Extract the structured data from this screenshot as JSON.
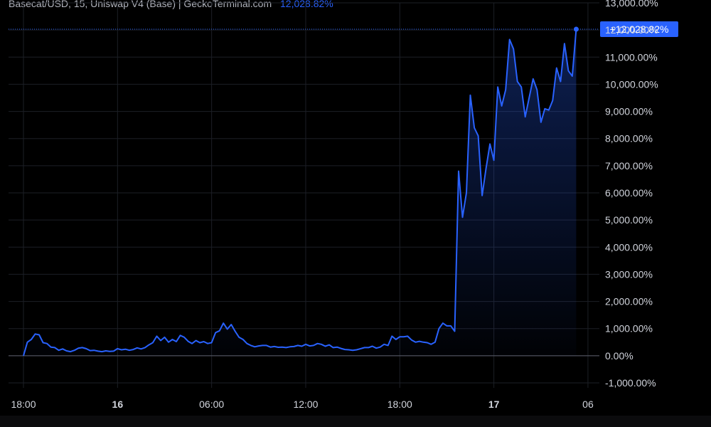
{
  "header": {
    "symbol": "Basecat/USD, 15, Uniswap V4 (Base) | GeckoTerminal.com",
    "value": "12,028.82%"
  },
  "colors": {
    "line": "#2962ff",
    "grid": "#1c1f26",
    "background": "#000000",
    "text": "#d1d4dc"
  },
  "chart_data": {
    "type": "area",
    "title": "",
    "xlabel": "",
    "ylabel": "",
    "ylim": [
      -1000,
      13000
    ],
    "y_ticks": [
      -1000,
      0,
      1000,
      2000,
      3000,
      4000,
      5000,
      6000,
      7000,
      8000,
      9000,
      10000,
      11000,
      12000,
      13000
    ],
    "y_tick_labels": [
      "-1,000.00%",
      "0.00%",
      "1,000.00%",
      "2,000.00%",
      "3,000.00%",
      "4,000.00%",
      "5,000.00%",
      "6,000.00%",
      "7,000.00%",
      "8,000.00%",
      "9,000.00%",
      "10,000.00%",
      "11,000.00%",
      "12,000.00%",
      "13,000.00%"
    ],
    "x_range": [
      "2024-01-15 18:00",
      "2024-01-17 07:00"
    ],
    "x_ticks": [
      {
        "label": "18:00",
        "x": "2024-01-15 18:00",
        "bold": false
      },
      {
        "label": "16",
        "x": "2024-01-16 00:00",
        "bold": true
      },
      {
        "label": "06:00",
        "x": "2024-01-16 06:00",
        "bold": false
      },
      {
        "label": "12:00",
        "x": "2024-01-16 12:00",
        "bold": false
      },
      {
        "label": "18:00",
        "x": "2024-01-16 18:00",
        "bold": false
      },
      {
        "label": "17",
        "x": "2024-01-17 00:00",
        "bold": true
      },
      {
        "label": "06",
        "x": "2024-01-17 06:00",
        "bold": false
      }
    ],
    "grid": true,
    "last_value_label": "+12,028.82%",
    "last_value": 12028.82,
    "series": [
      {
        "name": "",
        "points": [
          [
            "2024-01-15 18:00",
            0
          ],
          [
            "2024-01-15 18:15",
            500
          ],
          [
            "2024-01-15 18:30",
            600
          ],
          [
            "2024-01-15 18:45",
            800
          ],
          [
            "2024-01-15 19:00",
            770
          ],
          [
            "2024-01-15 19:15",
            480
          ],
          [
            "2024-01-15 19:30",
            450
          ],
          [
            "2024-01-15 19:45",
            320
          ],
          [
            "2024-01-15 20:00",
            300
          ],
          [
            "2024-01-15 20:15",
            200
          ],
          [
            "2024-01-15 20:30",
            250
          ],
          [
            "2024-01-15 20:45",
            180
          ],
          [
            "2024-01-15 21:00",
            150
          ],
          [
            "2024-01-15 21:15",
            200
          ],
          [
            "2024-01-15 21:30",
            280
          ],
          [
            "2024-01-15 21:45",
            300
          ],
          [
            "2024-01-15 22:00",
            260
          ],
          [
            "2024-01-15 22:15",
            190
          ],
          [
            "2024-01-15 22:30",
            200
          ],
          [
            "2024-01-15 22:45",
            170
          ],
          [
            "2024-01-15 23:00",
            150
          ],
          [
            "2024-01-15 23:15",
            180
          ],
          [
            "2024-01-15 23:30",
            160
          ],
          [
            "2024-01-15 23:45",
            170
          ],
          [
            "2024-01-16 00:00",
            260
          ],
          [
            "2024-01-16 00:15",
            220
          ],
          [
            "2024-01-16 00:30",
            240
          ],
          [
            "2024-01-16 00:45",
            200
          ],
          [
            "2024-01-16 01:00",
            230
          ],
          [
            "2024-01-16 01:15",
            290
          ],
          [
            "2024-01-16 01:30",
            250
          ],
          [
            "2024-01-16 01:45",
            300
          ],
          [
            "2024-01-16 02:00",
            400
          ],
          [
            "2024-01-16 02:15",
            480
          ],
          [
            "2024-01-16 02:30",
            720
          ],
          [
            "2024-01-16 02:45",
            560
          ],
          [
            "2024-01-16 03:00",
            680
          ],
          [
            "2024-01-16 03:15",
            500
          ],
          [
            "2024-01-16 03:30",
            600
          ],
          [
            "2024-01-16 03:45",
            520
          ],
          [
            "2024-01-16 04:00",
            750
          ],
          [
            "2024-01-16 04:15",
            680
          ],
          [
            "2024-01-16 04:30",
            530
          ],
          [
            "2024-01-16 04:45",
            450
          ],
          [
            "2024-01-16 05:00",
            560
          ],
          [
            "2024-01-16 05:15",
            480
          ],
          [
            "2024-01-16 05:30",
            520
          ],
          [
            "2024-01-16 05:45",
            450
          ],
          [
            "2024-01-16 06:00",
            480
          ],
          [
            "2024-01-16 06:15",
            850
          ],
          [
            "2024-01-16 06:30",
            920
          ],
          [
            "2024-01-16 06:45",
            1200
          ],
          [
            "2024-01-16 07:00",
            980
          ],
          [
            "2024-01-16 07:15",
            1150
          ],
          [
            "2024-01-16 07:30",
            900
          ],
          [
            "2024-01-16 07:45",
            680
          ],
          [
            "2024-01-16 08:00",
            600
          ],
          [
            "2024-01-16 08:15",
            450
          ],
          [
            "2024-01-16 08:30",
            380
          ],
          [
            "2024-01-16 08:45",
            330
          ],
          [
            "2024-01-16 09:00",
            360
          ],
          [
            "2024-01-16 09:15",
            380
          ],
          [
            "2024-01-16 09:30",
            380
          ],
          [
            "2024-01-16 09:45",
            320
          ],
          [
            "2024-01-16 10:00",
            340
          ],
          [
            "2024-01-16 10:15",
            310
          ],
          [
            "2024-01-16 10:30",
            320
          ],
          [
            "2024-01-16 10:45",
            300
          ],
          [
            "2024-01-16 11:00",
            330
          ],
          [
            "2024-01-16 11:15",
            340
          ],
          [
            "2024-01-16 11:30",
            380
          ],
          [
            "2024-01-16 11:45",
            350
          ],
          [
            "2024-01-16 12:00",
            420
          ],
          [
            "2024-01-16 12:15",
            360
          ],
          [
            "2024-01-16 12:30",
            380
          ],
          [
            "2024-01-16 12:45",
            450
          ],
          [
            "2024-01-16 13:00",
            420
          ],
          [
            "2024-01-16 13:15",
            350
          ],
          [
            "2024-01-16 13:30",
            400
          ],
          [
            "2024-01-16 13:45",
            300
          ],
          [
            "2024-01-16 14:00",
            320
          ],
          [
            "2024-01-16 14:15",
            270
          ],
          [
            "2024-01-16 14:30",
            230
          ],
          [
            "2024-01-16 14:45",
            220
          ],
          [
            "2024-01-16 15:00",
            200
          ],
          [
            "2024-01-16 15:15",
            220
          ],
          [
            "2024-01-16 15:30",
            260
          ],
          [
            "2024-01-16 15:45",
            300
          ],
          [
            "2024-01-16 16:00",
            300
          ],
          [
            "2024-01-16 16:15",
            350
          ],
          [
            "2024-01-16 16:30",
            280
          ],
          [
            "2024-01-16 16:45",
            320
          ],
          [
            "2024-01-16 17:00",
            420
          ],
          [
            "2024-01-16 17:15",
            380
          ],
          [
            "2024-01-16 17:30",
            720
          ],
          [
            "2024-01-16 17:45",
            600
          ],
          [
            "2024-01-16 18:00",
            700
          ],
          [
            "2024-01-16 18:15",
            700
          ],
          [
            "2024-01-16 18:30",
            720
          ],
          [
            "2024-01-16 18:45",
            580
          ],
          [
            "2024-01-16 19:00",
            500
          ],
          [
            "2024-01-16 19:15",
            530
          ],
          [
            "2024-01-16 19:30",
            500
          ],
          [
            "2024-01-16 19:45",
            480
          ],
          [
            "2024-01-16 20:00",
            420
          ],
          [
            "2024-01-16 20:15",
            500
          ],
          [
            "2024-01-16 20:30",
            1000
          ],
          [
            "2024-01-16 20:45",
            1200
          ],
          [
            "2024-01-16 21:00",
            1100
          ],
          [
            "2024-01-16 21:15",
            1100
          ],
          [
            "2024-01-16 21:30",
            900
          ],
          [
            "2024-01-16 21:45",
            6800
          ],
          [
            "2024-01-16 22:00",
            5100
          ],
          [
            "2024-01-16 22:15",
            6000
          ],
          [
            "2024-01-16 22:30",
            9600
          ],
          [
            "2024-01-16 22:45",
            8400
          ],
          [
            "2024-01-16 23:00",
            8100
          ],
          [
            "2024-01-16 23:15",
            5900
          ],
          [
            "2024-01-16 23:30",
            6900
          ],
          [
            "2024-01-16 23:45",
            7800
          ],
          [
            "2024-01-17 00:00",
            7200
          ],
          [
            "2024-01-17 00:15",
            9900
          ],
          [
            "2024-01-17 00:30",
            9200
          ],
          [
            "2024-01-17 00:45",
            9800
          ],
          [
            "2024-01-17 01:00",
            11650
          ],
          [
            "2024-01-17 01:15",
            11300
          ],
          [
            "2024-01-17 01:30",
            10100
          ],
          [
            "2024-01-17 01:45",
            9900
          ],
          [
            "2024-01-17 02:00",
            8800
          ],
          [
            "2024-01-17 02:15",
            9500
          ],
          [
            "2024-01-17 02:30",
            10200
          ],
          [
            "2024-01-17 02:45",
            9800
          ],
          [
            "2024-01-17 03:00",
            8600
          ],
          [
            "2024-01-17 03:15",
            9100
          ],
          [
            "2024-01-17 03:30",
            9050
          ],
          [
            "2024-01-17 03:45",
            9400
          ],
          [
            "2024-01-17 04:00",
            10600
          ],
          [
            "2024-01-17 04:15",
            10100
          ],
          [
            "2024-01-17 04:30",
            11500
          ],
          [
            "2024-01-17 04:45",
            10500
          ],
          [
            "2024-01-17 05:00",
            10300
          ],
          [
            "2024-01-17 05:15",
            12028.82
          ]
        ]
      }
    ]
  }
}
